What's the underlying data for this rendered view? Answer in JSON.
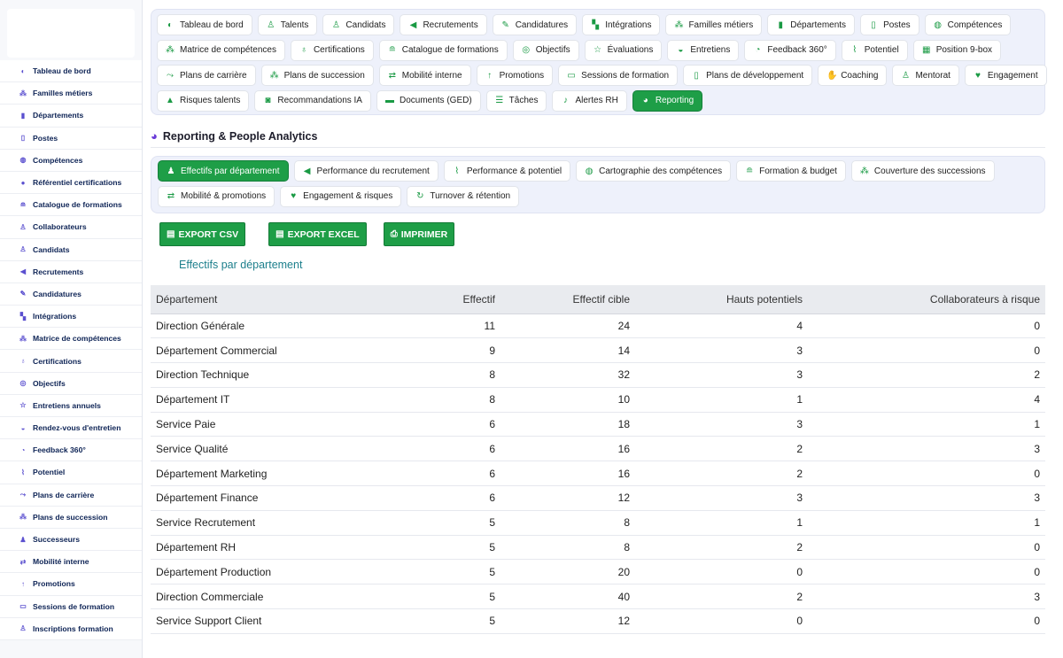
{
  "sidebar": {
    "items": [
      {
        "icon": "palette-icon",
        "glyph": "◐",
        "label": "Tableau de bord"
      },
      {
        "icon": "sitemap-icon",
        "glyph": "⁂",
        "label": "Familles métiers"
      },
      {
        "icon": "building-icon",
        "glyph": "▮",
        "label": "Départements"
      },
      {
        "icon": "id-badge-icon",
        "glyph": "▯",
        "label": "Postes"
      },
      {
        "icon": "brain-icon",
        "glyph": "◍",
        "label": "Compétences"
      },
      {
        "icon": "certificate-icon",
        "glyph": "●",
        "label": "Référentiel certifications"
      },
      {
        "icon": "graduation-cap-icon",
        "glyph": "≘",
        "label": "Catalogue de formations"
      },
      {
        "icon": "user-icon",
        "glyph": "♙",
        "label": "Collaborateurs"
      },
      {
        "icon": "user-plus-icon",
        "glyph": "♙",
        "label": "Candidats"
      },
      {
        "icon": "bullhorn-icon",
        "glyph": "◀",
        "label": "Recrutements"
      },
      {
        "icon": "file-signature-icon",
        "glyph": "✎",
        "label": "Candidatures"
      },
      {
        "icon": "door-open-icon",
        "glyph": "▚",
        "label": "Intégrations"
      },
      {
        "icon": "sitemap-icon",
        "glyph": "⁂",
        "label": "Matrice de compétences"
      },
      {
        "icon": "award-icon",
        "glyph": "♁",
        "label": "Certifications"
      },
      {
        "icon": "bullseye-icon",
        "glyph": "◎",
        "label": "Objectifs"
      },
      {
        "icon": "star-half-icon",
        "glyph": "☆",
        "label": "Entretiens annuels"
      },
      {
        "icon": "comments-icon",
        "glyph": "◒",
        "label": "Rendez-vous d'entretien"
      },
      {
        "icon": "comment-dots-icon",
        "glyph": "◔",
        "label": "Feedback 360°"
      },
      {
        "icon": "chart-line-icon",
        "glyph": "⌇",
        "label": "Potentiel"
      },
      {
        "icon": "route-icon",
        "glyph": "⤳",
        "label": "Plans de carrière"
      },
      {
        "icon": "sitemap-icon",
        "glyph": "⁂",
        "label": "Plans de succession"
      },
      {
        "icon": "users-icon",
        "glyph": "♟",
        "label": "Successeurs"
      },
      {
        "icon": "exchange-icon",
        "glyph": "⇄",
        "label": "Mobilité interne"
      },
      {
        "icon": "arrow-up-icon",
        "glyph": "↑",
        "label": "Promotions"
      },
      {
        "icon": "chalkboard-icon",
        "glyph": "▭",
        "label": "Sessions de formation"
      },
      {
        "icon": "user-graduate-icon",
        "glyph": "♙",
        "label": "Inscriptions formation"
      }
    ]
  },
  "top_nav": {
    "rows": [
      [
        {
          "icon": "palette-icon",
          "glyph": "◐",
          "label": "Tableau de bord"
        },
        {
          "icon": "user-icon",
          "glyph": "♙",
          "label": "Talents"
        },
        {
          "icon": "user-plus-icon",
          "glyph": "♙",
          "label": "Candidats"
        },
        {
          "icon": "bullhorn-icon",
          "glyph": "◀",
          "label": "Recrutements"
        },
        {
          "icon": "file-signature-icon",
          "glyph": "✎",
          "label": "Candidatures"
        },
        {
          "icon": "door-open-icon",
          "glyph": "▚",
          "label": "Intégrations"
        },
        {
          "icon": "sitemap-icon",
          "glyph": "⁂",
          "label": "Familles métiers"
        },
        {
          "icon": "building-icon",
          "glyph": "▮",
          "label": "Départements"
        },
        {
          "icon": "id-badge-icon",
          "glyph": "▯",
          "label": "Postes"
        },
        {
          "icon": "brain-icon",
          "glyph": "◍",
          "label": "Compétences"
        }
      ],
      [
        {
          "icon": "sitemap-icon",
          "glyph": "⁂",
          "label": "Matrice de compétences"
        },
        {
          "icon": "award-icon",
          "glyph": "♁",
          "label": "Certifications"
        },
        {
          "icon": "graduation-cap-icon",
          "glyph": "≘",
          "label": "Catalogue de formations"
        },
        {
          "icon": "bullseye-icon",
          "glyph": "◎",
          "label": "Objectifs"
        },
        {
          "icon": "star-half-icon",
          "glyph": "☆",
          "label": "Évaluations"
        },
        {
          "icon": "comments-icon",
          "glyph": "◒",
          "label": "Entretiens"
        },
        {
          "icon": "comment-dots-icon",
          "glyph": "◔",
          "label": "Feedback 360°"
        },
        {
          "icon": "chart-line-icon",
          "glyph": "⌇",
          "label": "Potentiel"
        },
        {
          "icon": "grid-icon",
          "glyph": "▦",
          "label": "Position 9-box"
        }
      ],
      [
        {
          "icon": "route-icon",
          "glyph": "⤳",
          "label": "Plans de carrière"
        },
        {
          "icon": "sitemap-icon",
          "glyph": "⁂",
          "label": "Plans de succession"
        },
        {
          "icon": "exchange-icon",
          "glyph": "⇄",
          "label": "Mobilité interne"
        },
        {
          "icon": "arrow-up-icon",
          "glyph": "↑",
          "label": "Promotions"
        },
        {
          "icon": "chalkboard-icon",
          "glyph": "▭",
          "label": "Sessions de formation"
        },
        {
          "icon": "clipboard-icon",
          "glyph": "▯",
          "label": "Plans de développement"
        },
        {
          "icon": "handshake-icon",
          "glyph": "✋",
          "label": "Coaching"
        },
        {
          "icon": "chalkboard-teacher-icon",
          "glyph": "♙",
          "label": "Mentorat"
        },
        {
          "icon": "heart-icon",
          "glyph": "♥",
          "label": "Engagement"
        }
      ],
      [
        {
          "icon": "warning-icon",
          "glyph": "▲",
          "label": "Risques talents"
        },
        {
          "icon": "robot-icon",
          "glyph": "◙",
          "label": "Recommandations IA"
        },
        {
          "icon": "folder-open-icon",
          "glyph": "▬",
          "label": "Documents (GED)"
        },
        {
          "icon": "tasks-icon",
          "glyph": "☰",
          "label": "Tâches"
        },
        {
          "icon": "bell-icon",
          "glyph": "♪",
          "label": "Alertes RH"
        },
        {
          "icon": "chart-pie-icon",
          "glyph": "◕",
          "label": "Reporting",
          "active": true
        }
      ]
    ]
  },
  "section": {
    "icon": "chart-pie-icon",
    "glyph": "◕",
    "title": "Reporting & People Analytics"
  },
  "report_tabs": {
    "rows": [
      [
        {
          "icon": "users-icon",
          "glyph": "♟",
          "label": "Effectifs par département",
          "active": true
        },
        {
          "icon": "bullhorn-icon",
          "glyph": "◀",
          "label": "Performance du recrutement"
        },
        {
          "icon": "chart-line-icon",
          "glyph": "⌇",
          "label": "Performance & potentiel"
        },
        {
          "icon": "brain-icon",
          "glyph": "◍",
          "label": "Cartographie des compétences"
        },
        {
          "icon": "graduation-cap-icon",
          "glyph": "≘",
          "label": "Formation & budget"
        },
        {
          "icon": "sitemap-icon",
          "glyph": "⁂",
          "label": "Couverture des successions"
        }
      ],
      [
        {
          "icon": "exchange-icon",
          "glyph": "⇄",
          "label": "Mobilité & promotions"
        },
        {
          "icon": "heart-icon",
          "glyph": "♥",
          "label": "Engagement & risques"
        },
        {
          "icon": "sync-icon",
          "glyph": "↻",
          "label": "Turnover & rétention"
        }
      ]
    ]
  },
  "exports": [
    {
      "name": "export-csv-button",
      "icon": "file-csv-icon",
      "glyph": "▤",
      "label": "EXPORT CSV"
    },
    {
      "name": "export-excel-button",
      "icon": "file-excel-icon",
      "glyph": "▤",
      "label": "EXPORT EXCEL"
    },
    {
      "name": "print-button",
      "icon": "print-icon",
      "glyph": "⎙",
      "label": "IMPRIMER"
    }
  ],
  "table": {
    "caption": "Effectifs par département",
    "headers": [
      "Département",
      "Effectif",
      "Effectif cible",
      "Hauts potentiels",
      "Collaborateurs à risque"
    ],
    "rows": [
      [
        "Direction Générale",
        "11",
        "24",
        "4",
        "0"
      ],
      [
        "Département Commercial",
        "9",
        "14",
        "3",
        "0"
      ],
      [
        "Direction Technique",
        "8",
        "32",
        "3",
        "2"
      ],
      [
        "Département IT",
        "8",
        "10",
        "1",
        "4"
      ],
      [
        "Service Paie",
        "6",
        "18",
        "3",
        "1"
      ],
      [
        "Service Qualité",
        "6",
        "16",
        "2",
        "3"
      ],
      [
        "Département Marketing",
        "6",
        "16",
        "2",
        "0"
      ],
      [
        "Département Finance",
        "6",
        "12",
        "3",
        "3"
      ],
      [
        "Service Recrutement",
        "5",
        "8",
        "1",
        "1"
      ],
      [
        "Département RH",
        "5",
        "8",
        "2",
        "0"
      ],
      [
        "Département Production",
        "5",
        "20",
        "0",
        "0"
      ],
      [
        "Direction Commerciale",
        "5",
        "40",
        "2",
        "3"
      ],
      [
        "Service Support Client",
        "5",
        "12",
        "0",
        "0"
      ]
    ]
  }
}
